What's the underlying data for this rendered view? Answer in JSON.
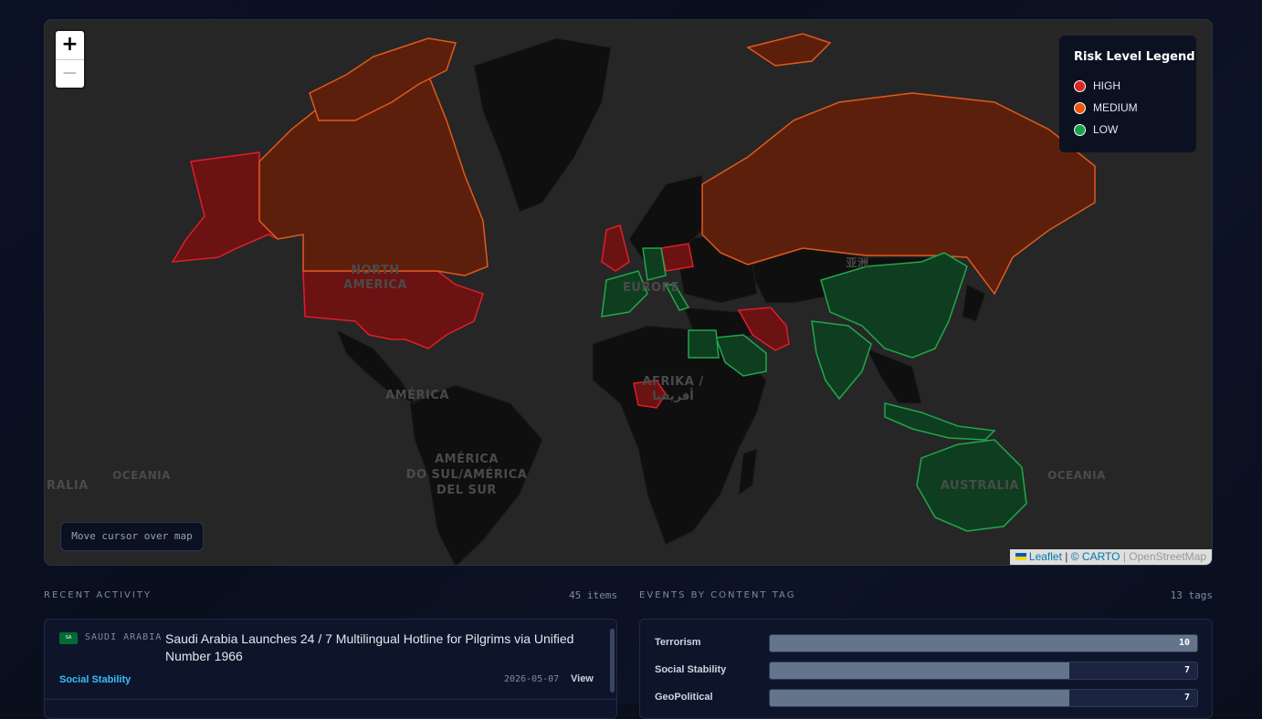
{
  "map": {
    "zoom_in_label": "+",
    "zoom_out_label": "−",
    "legend": {
      "title": "Risk Level Legend",
      "items": [
        {
          "label": "HIGH",
          "color": "#dc2626"
        },
        {
          "label": "MEDIUM",
          "color": "#ea580c"
        },
        {
          "label": "LOW",
          "color": "#16a34a"
        }
      ]
    },
    "cursor_readout": "Move cursor over map",
    "continent_labels": {
      "north_america": [
        "NORTH",
        "AMERICA"
      ],
      "america": "AMÉRICA",
      "south_america": [
        "AMÉRICA",
        "DO SUL/AMÉRICA",
        "DEL SUR"
      ],
      "europe": "EUROPE",
      "africa": [
        "AFRIKA /",
        "أفريقيا"
      ],
      "australia": "AUSTRALIA",
      "oceania_left": "OCEANIA",
      "oceania_right": "OCEANIA",
      "ralia": "RALIA",
      "asia": "亚洲"
    },
    "attribution": {
      "leaflet": "Leaflet",
      "sep": " | ",
      "carto": "© CARTO",
      "osm": "OpenStreetMap"
    },
    "risk_colors": {
      "high_fill": "#7f1d1d",
      "high_stroke": "#ef4444",
      "medium_fill": "#7c2d12",
      "medium_stroke": "#f97316",
      "low_fill": "#14532d",
      "low_stroke": "#22c55e"
    }
  },
  "recent_activity": {
    "heading": "RECENT ACTIVITY",
    "count": "45 items",
    "items": [
      {
        "flag_label": "SA",
        "country": "SAUDI ARABIA",
        "title": "Saudi Arabia Launches 24 / 7 Multilingual Hotline for Pilgrims via Unified Number 1966",
        "tag": "Social Stability",
        "date": "2026-05-07",
        "action": "View"
      }
    ]
  },
  "content_tags": {
    "heading": "EVENTS BY CONTENT TAG",
    "count": "13 tags",
    "items": [
      {
        "label": "Terrorism",
        "value": 10,
        "value_text": "10"
      },
      {
        "label": "Social Stability",
        "value": 7,
        "value_text": "7"
      },
      {
        "label": "GeoPolitical",
        "value": 7,
        "value_text": "7"
      }
    ]
  }
}
